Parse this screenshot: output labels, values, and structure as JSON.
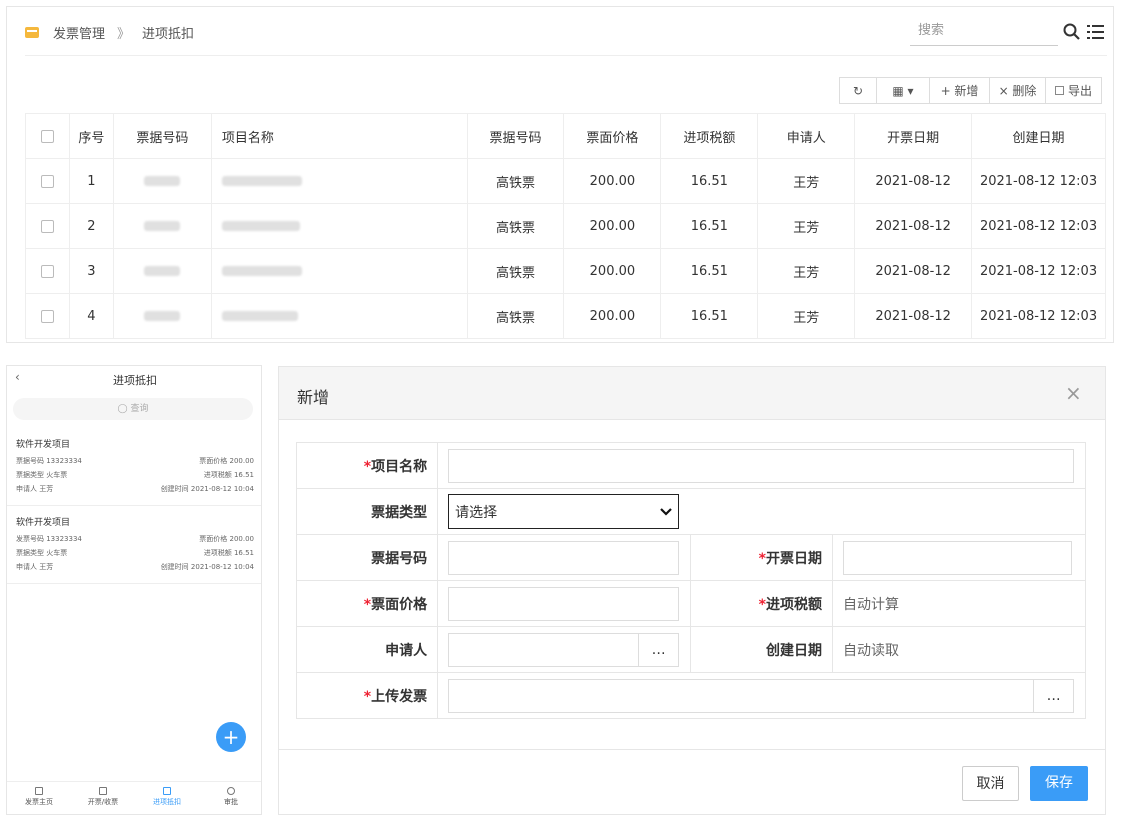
{
  "breadcrumb": {
    "root": "发票管理",
    "sep": "》",
    "current": "进项抵扣"
  },
  "search": {
    "placeholder": "搜索"
  },
  "toolbar": {
    "refresh_icon": "↻",
    "columns_icon": "▦ ▾",
    "add": "+ 新增",
    "delete": "× 删除",
    "export": "导出"
  },
  "table": {
    "headers": [
      "序号",
      "票据号码",
      "项目名称",
      "票据号码",
      "票面价格",
      "进项税额",
      "申请人",
      "开票日期",
      "创建日期"
    ],
    "rows": [
      {
        "idx": "1",
        "type": "高铁票",
        "price": "200.00",
        "tax": "16.51",
        "applicant": "王芳",
        "inv_date": "2021-08-12",
        "created": "2021-08-12  12:03"
      },
      {
        "idx": "2",
        "type": "高铁票",
        "price": "200.00",
        "tax": "16.51",
        "applicant": "王芳",
        "inv_date": "2021-08-12",
        "created": "2021-08-12  12:03"
      },
      {
        "idx": "3",
        "type": "高铁票",
        "price": "200.00",
        "tax": "16.51",
        "applicant": "王芳",
        "inv_date": "2021-08-12",
        "created": "2021-08-12  12:03"
      },
      {
        "idx": "4",
        "type": "高铁票",
        "price": "200.00",
        "tax": "16.51",
        "applicant": "王芳",
        "inv_date": "2021-08-12",
        "created": "2021-08-12  12:03"
      }
    ]
  },
  "mobile": {
    "back": "‹",
    "title": "进项抵扣",
    "search": "◯ 查询",
    "cards": [
      {
        "title": "软件开发项目",
        "no_label": "票据号码 13323334",
        "price_label": "票面价格  200.00",
        "type_label": "票据类型  火车票",
        "tax_label": "进项税额  16.51",
        "applicant_label": "申请人  王芳",
        "created_label": "创建时间  2021-08-12 10:04"
      },
      {
        "title": "软件开发项目",
        "no_label": "发票号码 13323334",
        "price_label": "票面价格  200.00",
        "type_label": "票据类型  火车票",
        "tax_label": "进项税额  16.51",
        "applicant_label": "申请人  王芳",
        "created_label": "创建时间  2021-08-12 10:04"
      }
    ],
    "fab": "+",
    "tabs": [
      "发票主页",
      "开票/收票",
      "进项抵扣",
      "审批"
    ]
  },
  "dialog": {
    "title": "新增",
    "close": "×",
    "req": "*",
    "labels": {
      "project": "项目名称",
      "bill_type": "票据类型",
      "bill_no": "票据号码",
      "inv_date": "开票日期",
      "price": "票面价格",
      "tax": "进项税额",
      "applicant": "申请人",
      "created": "创建日期",
      "upload": "上传发票"
    },
    "select_value": "请选择",
    "tax_value": "自动计算",
    "created_value": "自动读取",
    "dots": "…",
    "cancel": "取消",
    "save": "保存"
  },
  "colors": {
    "accent": "#3a9cf7",
    "required": "#e23"
  }
}
